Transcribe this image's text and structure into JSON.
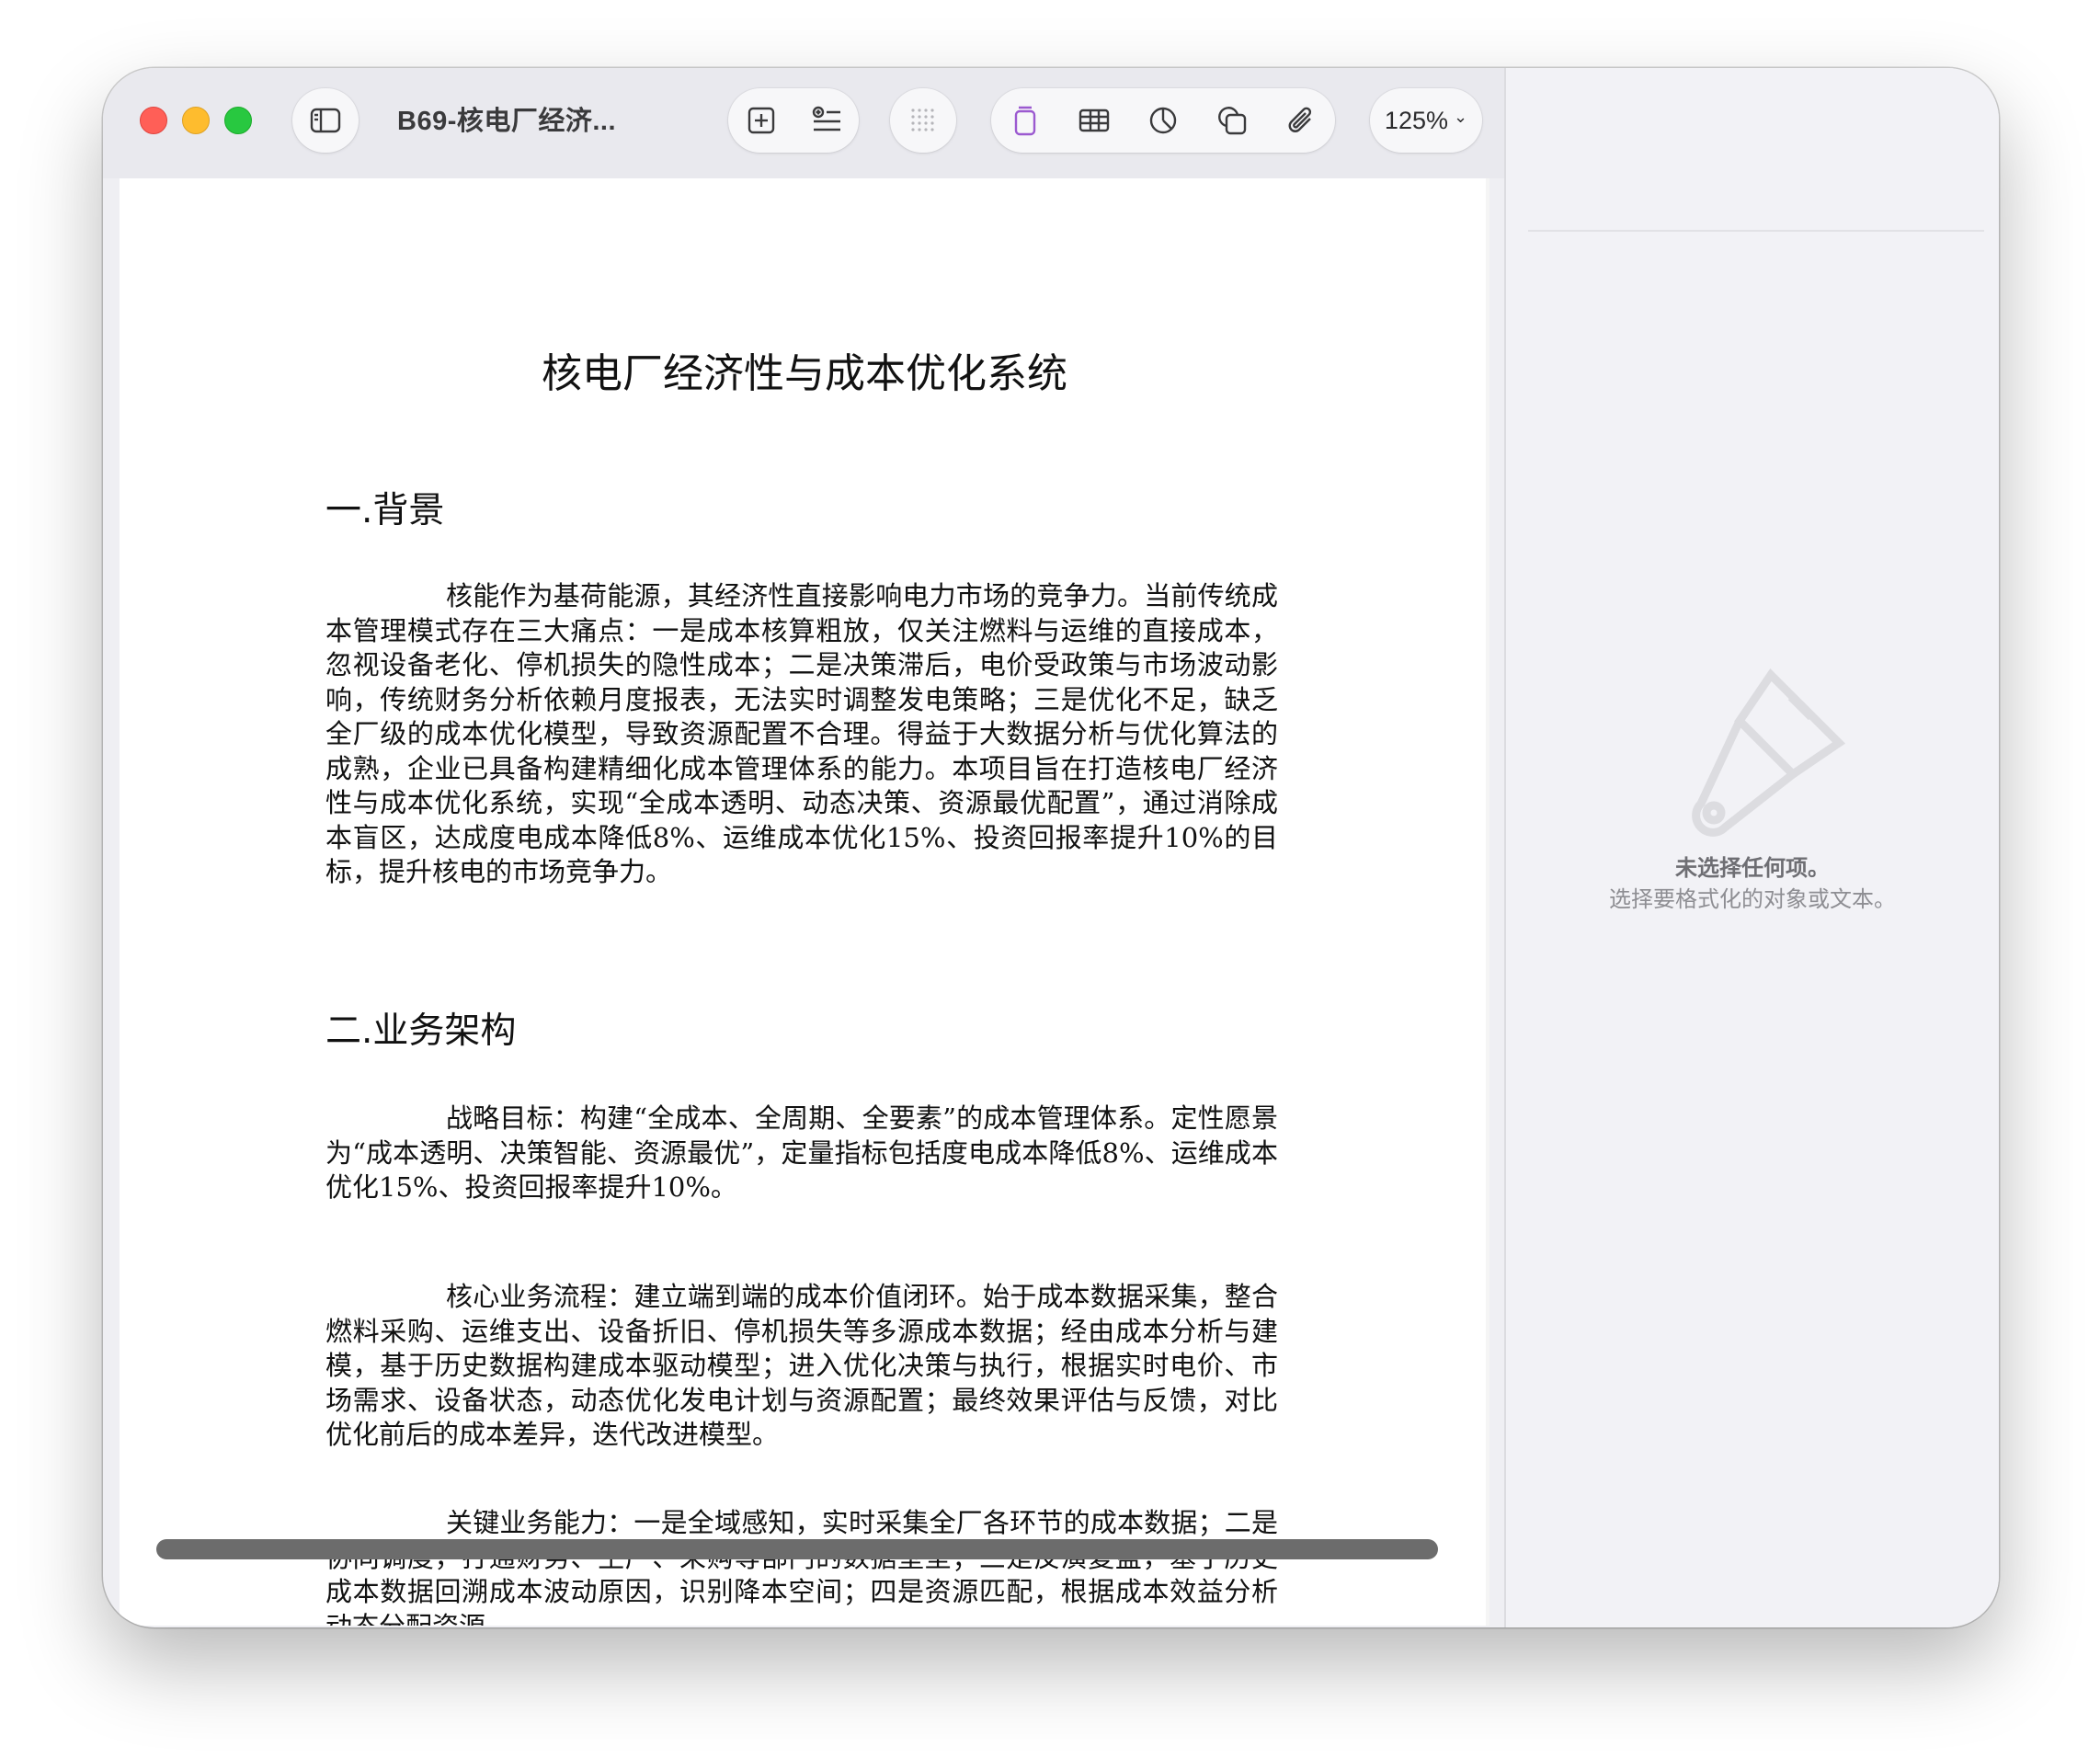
{
  "window": {
    "title": "B69-核电厂经济...",
    "zoom": "125%",
    "chevron": "⌄"
  },
  "toolbar": {
    "icons": [
      "sidebar-icon",
      "add-page-icon",
      "text-box-icon",
      "grid-icon",
      "document-icon",
      "table-icon",
      "chart-icon",
      "shape-icon",
      "attachment-icon",
      "comment-icon",
      "share-icon",
      "format-brush-icon",
      "document-panel-icon"
    ]
  },
  "document": {
    "title": "核电厂经济性与成本优化系统",
    "section1_heading": "一.背景",
    "section1_para": "核能作为基荷能源，其经济性直接影响电力市场的竞争力。当前传统成本管理模式存在三大痛点：一是成本核算粗放，仅关注燃料与运维的直接成本，忽视设备老化、停机损失的隐性成本；二是决策滞后，电价受政策与市场波动影响，传统财务分析依赖月度报表，无法实时调整发电策略；三是优化不足，缺乏全厂级的成本优化模型，导致资源配置不合理。得益于大数据分析与优化算法的成熟，企业已具备构建精细化成本管理体系的能力。本项目旨在打造核电厂经济性与成本优化系统，实现“全成本透明、动态决策、资源最优配置”，通过消除成本盲区，达成度电成本降低8%、运维成本优化15%、投资回报率提升10%的目标，提升核电的市场竞争力。",
    "section2_heading": "二.业务架构",
    "section2_para1": "战略目标：构建“全成本、全周期、全要素”的成本管理体系。定性愿景为“成本透明、决策智能、资源最优”，定量指标包括度电成本降低8%、运维成本优化15%、投资回报率提升10%。",
    "section2_para2": "核心业务流程：建立端到端的成本价值闭环。始于成本数据采集，整合燃料采购、运维支出、设备折旧、停机损失等多源成本数据；经由成本分析与建模，基于历史数据构建成本驱动模型；进入优化决策与执行，根据实时电价、市场需求、设备状态，动态优化发电计划与资源配置；最终效果评估与反馈，对比优化前后的成本差异，迭代改进模型。",
    "section2_para3": "关键业务能力：一是全域感知，实时采集全厂各环节的成本数据；二是协同调度，打通财务、生产、采购等部门的数据壁垒；三是反演复盘，基于历史成本数据回溯成本波动原因，识别降本空间；四是资源匹配，根据成本效益分析动态分配资源。"
  },
  "inspector": {
    "empty_title": "未选择任何项。",
    "empty_subtitle": "选择要格式化的对象或文本。"
  }
}
